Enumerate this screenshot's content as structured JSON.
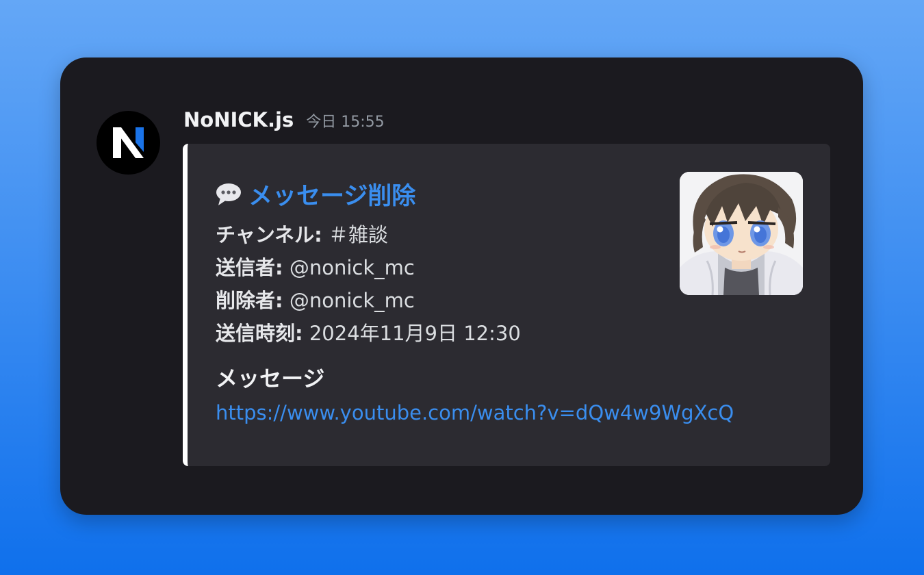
{
  "message": {
    "author": "NoNICK.js",
    "timestamp": "今日 15:55",
    "avatar_icon": "nonick-n-logo-icon",
    "avatar_letter": "N"
  },
  "embed": {
    "title_icon": "speech-bubble-icon",
    "title": "メッセージ削除",
    "fields": [
      {
        "label": "チャンネル:",
        "value": "＃雑談"
      },
      {
        "label": "送信者:",
        "value": "@nonick_mc"
      },
      {
        "label": "削除者:",
        "value": "@nonick_mc"
      },
      {
        "label": "送信時刻:",
        "value": "2024年11月9日 12:30"
      }
    ],
    "section_title": "メッセージ",
    "link": "https://www.youtube.com/watch?v=dQw4w9WgXcQ",
    "thumbnail_icon": "anime-avatar-thumbnail"
  },
  "colors": {
    "background_top": "#64a7f6",
    "background_bottom": "#0f70ec",
    "card": "#1b1a1f",
    "embed": "#2c2b31",
    "embed_accent": "#ffffff",
    "title_link": "#3a8eef",
    "logo_accent": "#1a73e8"
  }
}
